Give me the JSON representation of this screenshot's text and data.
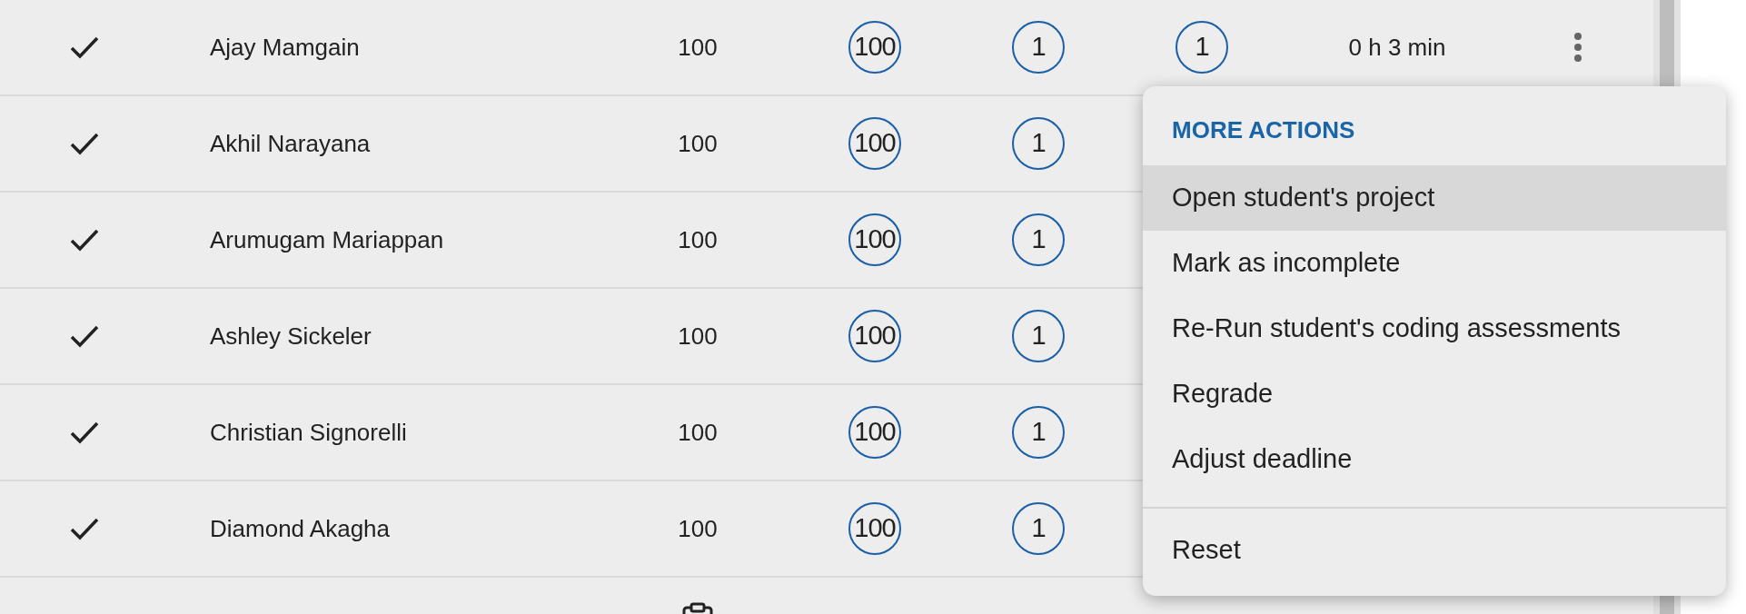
{
  "rows": [
    {
      "kind": "full",
      "checked": true,
      "name": "Ajay Mamgain",
      "column_3": "100",
      "column_4": "100",
      "column_5": "1",
      "column_6": "1",
      "column_7": "0 h 3 min"
    },
    {
      "kind": "full",
      "checked": true,
      "name": "Akhil Narayana",
      "column_3": "100",
      "column_4": "100",
      "column_5": "1"
    },
    {
      "kind": "full",
      "checked": true,
      "name": "Arumugam Mariappan",
      "column_3": "100",
      "column_4": "100",
      "column_5": "1"
    },
    {
      "kind": "full",
      "checked": true,
      "name": "Ashley Sickeler",
      "column_3": "100",
      "column_4": "100",
      "column_5": "1"
    },
    {
      "kind": "full",
      "checked": true,
      "name": "Christian Signorelli",
      "column_3": "100",
      "column_4": "100",
      "column_5": "1"
    },
    {
      "kind": "full",
      "checked": true,
      "name": "Diamond Akagha",
      "column_3": "100",
      "column_4": "100",
      "column_5": "1"
    },
    {
      "kind": "cut_off"
    }
  ],
  "menu": {
    "title": "MORE ACTIONS",
    "items": [
      {
        "label": "Open student's project",
        "selected": true
      },
      {
        "label": "Mark as incomplete",
        "selected": false
      },
      {
        "label": "Re-Run student's coding assessments",
        "selected": false
      },
      {
        "label": "Regrade",
        "selected": false
      },
      {
        "label": "Adjust deadline",
        "selected": false
      }
    ],
    "footer_items": [
      {
        "label": "Reset",
        "selected": false
      }
    ]
  }
}
